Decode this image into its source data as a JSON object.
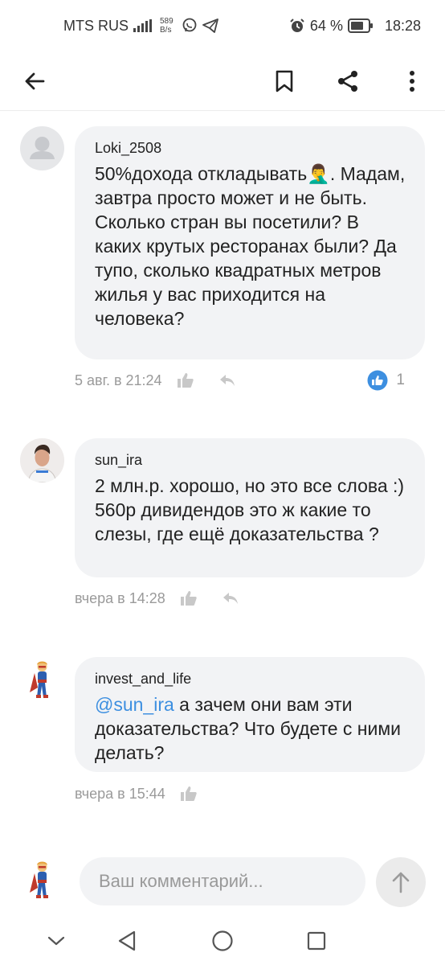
{
  "status_bar": {
    "carrier": "MTS RUS",
    "net_speed_value": "589",
    "net_speed_unit": "B/s",
    "battery_percent": "64 %",
    "time": "18:28"
  },
  "app_bar": {
    "back_icon": "arrow-left-icon",
    "bookmark_icon": "bookmark-icon",
    "share_icon": "share-icon",
    "more_icon": "more-vertical-icon"
  },
  "comments": [
    {
      "author": "Loki_2508",
      "text": "50%дохода откладывать🤦‍♂️. Мадам, завтра просто может и не быть. Сколько стран вы посетили? В каких крутых ресторанах были? Да тупо, сколько квадратных метров жилья у вас приходится на человека?",
      "timestamp": "5 авг. в 21:24",
      "likes": "1"
    },
    {
      "author": "sun_ira",
      "text": "2 млн.р. хорошо, но это все слова :) 560р дивидендов это ж какие то слезы, где ещё доказательства ?",
      "timestamp": "вчера в 14:28"
    },
    {
      "author": "invest_and_life",
      "mention": "@sun_ira",
      "text": " а зачем они вам эти доказательства? Что будете с ними делать?",
      "timestamp": "вчера в 15:44"
    }
  ],
  "composer": {
    "placeholder": "Ваш комментарий..."
  },
  "colors": {
    "bubble": "#f2f3f5",
    "mention": "#3d8fe0",
    "like_badge": "#3d8fe0"
  }
}
